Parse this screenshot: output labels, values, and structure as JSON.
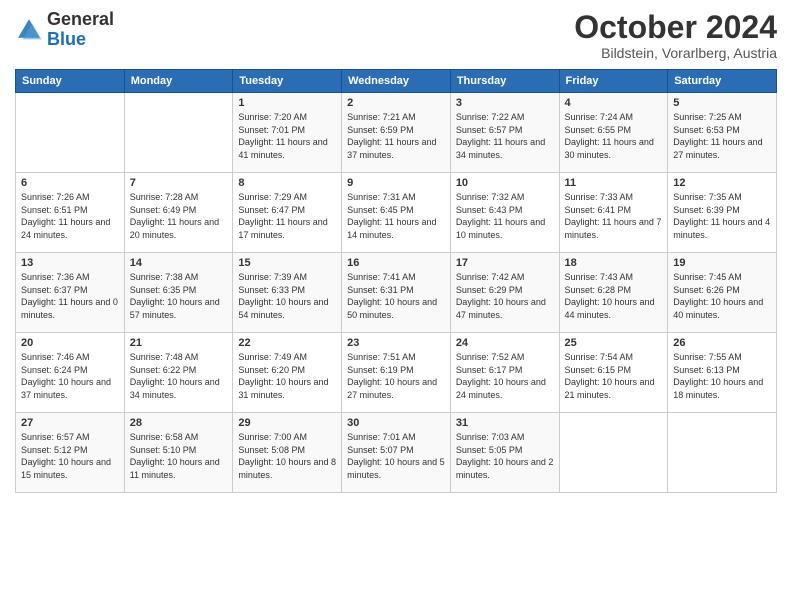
{
  "header": {
    "logo_general": "General",
    "logo_blue": "Blue",
    "month_title": "October 2024",
    "location": "Bildstein, Vorarlberg, Austria"
  },
  "weekdays": [
    "Sunday",
    "Monday",
    "Tuesday",
    "Wednesday",
    "Thursday",
    "Friday",
    "Saturday"
  ],
  "weeks": [
    [
      {
        "day": "",
        "sunrise": "",
        "sunset": "",
        "daylight": ""
      },
      {
        "day": "",
        "sunrise": "",
        "sunset": "",
        "daylight": ""
      },
      {
        "day": "1",
        "sunrise": "Sunrise: 7:20 AM",
        "sunset": "Sunset: 7:01 PM",
        "daylight": "Daylight: 11 hours and 41 minutes."
      },
      {
        "day": "2",
        "sunrise": "Sunrise: 7:21 AM",
        "sunset": "Sunset: 6:59 PM",
        "daylight": "Daylight: 11 hours and 37 minutes."
      },
      {
        "day": "3",
        "sunrise": "Sunrise: 7:22 AM",
        "sunset": "Sunset: 6:57 PM",
        "daylight": "Daylight: 11 hours and 34 minutes."
      },
      {
        "day": "4",
        "sunrise": "Sunrise: 7:24 AM",
        "sunset": "Sunset: 6:55 PM",
        "daylight": "Daylight: 11 hours and 30 minutes."
      },
      {
        "day": "5",
        "sunrise": "Sunrise: 7:25 AM",
        "sunset": "Sunset: 6:53 PM",
        "daylight": "Daylight: 11 hours and 27 minutes."
      }
    ],
    [
      {
        "day": "6",
        "sunrise": "Sunrise: 7:26 AM",
        "sunset": "Sunset: 6:51 PM",
        "daylight": "Daylight: 11 hours and 24 minutes."
      },
      {
        "day": "7",
        "sunrise": "Sunrise: 7:28 AM",
        "sunset": "Sunset: 6:49 PM",
        "daylight": "Daylight: 11 hours and 20 minutes."
      },
      {
        "day": "8",
        "sunrise": "Sunrise: 7:29 AM",
        "sunset": "Sunset: 6:47 PM",
        "daylight": "Daylight: 11 hours and 17 minutes."
      },
      {
        "day": "9",
        "sunrise": "Sunrise: 7:31 AM",
        "sunset": "Sunset: 6:45 PM",
        "daylight": "Daylight: 11 hours and 14 minutes."
      },
      {
        "day": "10",
        "sunrise": "Sunrise: 7:32 AM",
        "sunset": "Sunset: 6:43 PM",
        "daylight": "Daylight: 11 hours and 10 minutes."
      },
      {
        "day": "11",
        "sunrise": "Sunrise: 7:33 AM",
        "sunset": "Sunset: 6:41 PM",
        "daylight": "Daylight: 11 hours and 7 minutes."
      },
      {
        "day": "12",
        "sunrise": "Sunrise: 7:35 AM",
        "sunset": "Sunset: 6:39 PM",
        "daylight": "Daylight: 11 hours and 4 minutes."
      }
    ],
    [
      {
        "day": "13",
        "sunrise": "Sunrise: 7:36 AM",
        "sunset": "Sunset: 6:37 PM",
        "daylight": "Daylight: 11 hours and 0 minutes."
      },
      {
        "day": "14",
        "sunrise": "Sunrise: 7:38 AM",
        "sunset": "Sunset: 6:35 PM",
        "daylight": "Daylight: 10 hours and 57 minutes."
      },
      {
        "day": "15",
        "sunrise": "Sunrise: 7:39 AM",
        "sunset": "Sunset: 6:33 PM",
        "daylight": "Daylight: 10 hours and 54 minutes."
      },
      {
        "day": "16",
        "sunrise": "Sunrise: 7:41 AM",
        "sunset": "Sunset: 6:31 PM",
        "daylight": "Daylight: 10 hours and 50 minutes."
      },
      {
        "day": "17",
        "sunrise": "Sunrise: 7:42 AM",
        "sunset": "Sunset: 6:29 PM",
        "daylight": "Daylight: 10 hours and 47 minutes."
      },
      {
        "day": "18",
        "sunrise": "Sunrise: 7:43 AM",
        "sunset": "Sunset: 6:28 PM",
        "daylight": "Daylight: 10 hours and 44 minutes."
      },
      {
        "day": "19",
        "sunrise": "Sunrise: 7:45 AM",
        "sunset": "Sunset: 6:26 PM",
        "daylight": "Daylight: 10 hours and 40 minutes."
      }
    ],
    [
      {
        "day": "20",
        "sunrise": "Sunrise: 7:46 AM",
        "sunset": "Sunset: 6:24 PM",
        "daylight": "Daylight: 10 hours and 37 minutes."
      },
      {
        "day": "21",
        "sunrise": "Sunrise: 7:48 AM",
        "sunset": "Sunset: 6:22 PM",
        "daylight": "Daylight: 10 hours and 34 minutes."
      },
      {
        "day": "22",
        "sunrise": "Sunrise: 7:49 AM",
        "sunset": "Sunset: 6:20 PM",
        "daylight": "Daylight: 10 hours and 31 minutes."
      },
      {
        "day": "23",
        "sunrise": "Sunrise: 7:51 AM",
        "sunset": "Sunset: 6:19 PM",
        "daylight": "Daylight: 10 hours and 27 minutes."
      },
      {
        "day": "24",
        "sunrise": "Sunrise: 7:52 AM",
        "sunset": "Sunset: 6:17 PM",
        "daylight": "Daylight: 10 hours and 24 minutes."
      },
      {
        "day": "25",
        "sunrise": "Sunrise: 7:54 AM",
        "sunset": "Sunset: 6:15 PM",
        "daylight": "Daylight: 10 hours and 21 minutes."
      },
      {
        "day": "26",
        "sunrise": "Sunrise: 7:55 AM",
        "sunset": "Sunset: 6:13 PM",
        "daylight": "Daylight: 10 hours and 18 minutes."
      }
    ],
    [
      {
        "day": "27",
        "sunrise": "Sunrise: 6:57 AM",
        "sunset": "Sunset: 5:12 PM",
        "daylight": "Daylight: 10 hours and 15 minutes."
      },
      {
        "day": "28",
        "sunrise": "Sunrise: 6:58 AM",
        "sunset": "Sunset: 5:10 PM",
        "daylight": "Daylight: 10 hours and 11 minutes."
      },
      {
        "day": "29",
        "sunrise": "Sunrise: 7:00 AM",
        "sunset": "Sunset: 5:08 PM",
        "daylight": "Daylight: 10 hours and 8 minutes."
      },
      {
        "day": "30",
        "sunrise": "Sunrise: 7:01 AM",
        "sunset": "Sunset: 5:07 PM",
        "daylight": "Daylight: 10 hours and 5 minutes."
      },
      {
        "day": "31",
        "sunrise": "Sunrise: 7:03 AM",
        "sunset": "Sunset: 5:05 PM",
        "daylight": "Daylight: 10 hours and 2 minutes."
      },
      {
        "day": "",
        "sunrise": "",
        "sunset": "",
        "daylight": ""
      },
      {
        "day": "",
        "sunrise": "",
        "sunset": "",
        "daylight": ""
      }
    ]
  ]
}
